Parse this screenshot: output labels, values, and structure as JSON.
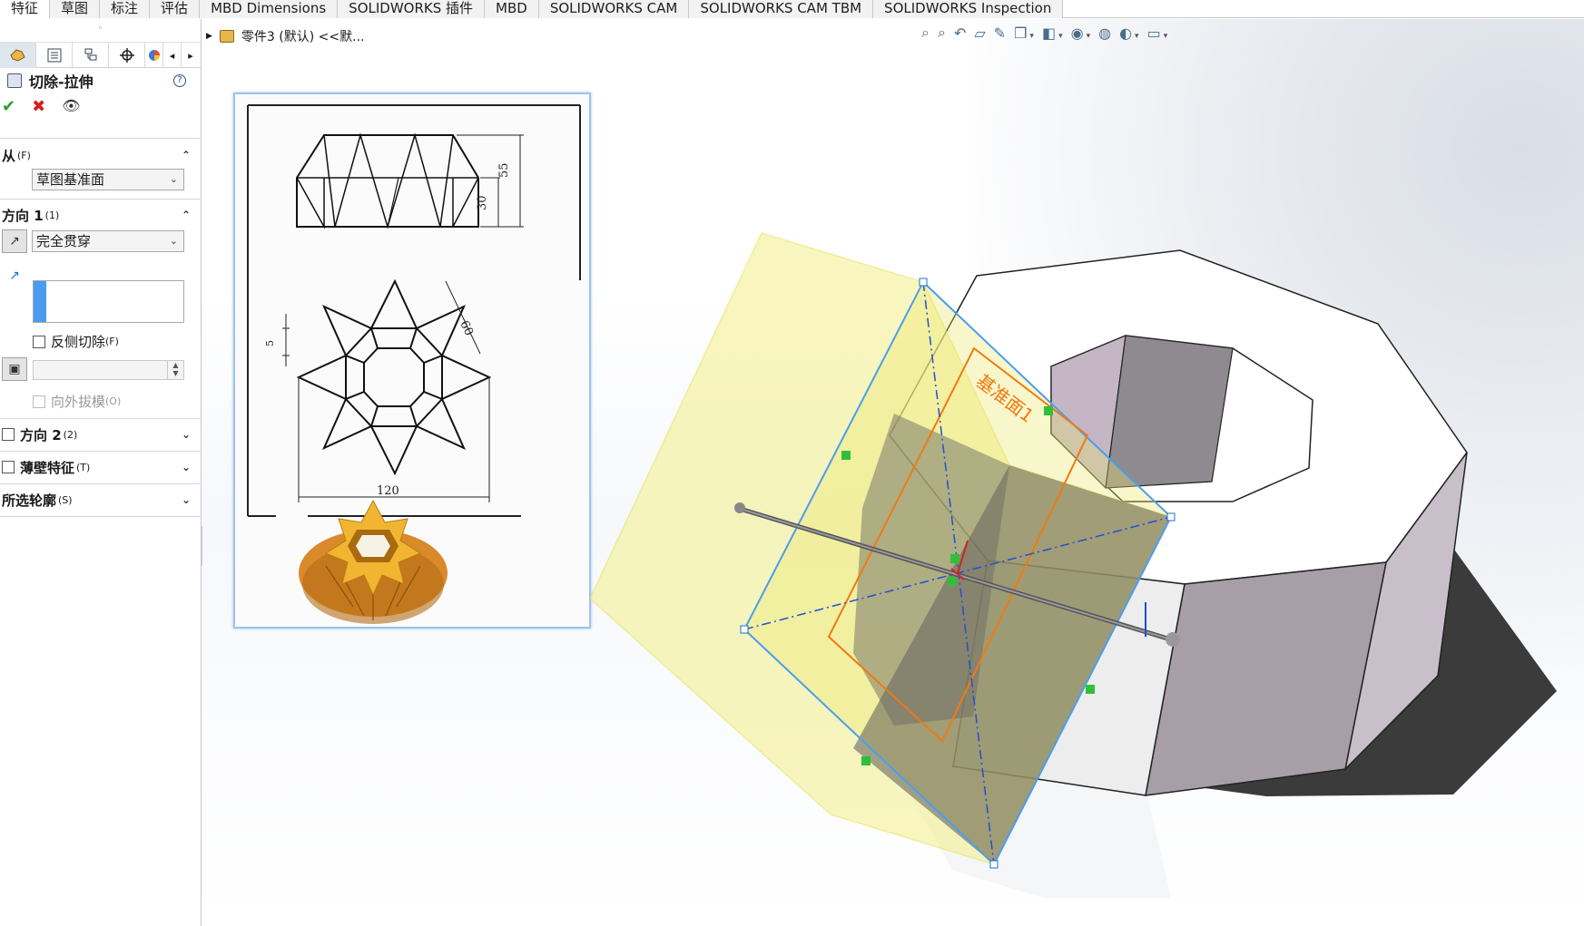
{
  "tabs": [
    {
      "label": "特征",
      "active": true
    },
    {
      "label": "草图",
      "active": false
    },
    {
      "label": "标注",
      "active": false
    },
    {
      "label": "评估",
      "active": false
    },
    {
      "label": "MBD Dimensions",
      "active": false
    },
    {
      "label": "SOLIDWORKS 插件",
      "active": false
    },
    {
      "label": "MBD",
      "active": false
    },
    {
      "label": "SOLIDWORKS CAM",
      "active": false
    },
    {
      "label": "SOLIDWORKS CAM TBM",
      "active": false
    },
    {
      "label": "SOLIDWORKS Inspection",
      "active": false
    }
  ],
  "breadcrumb": {
    "part_name": "零件3 (默认) <<默..."
  },
  "property_manager": {
    "title": "切除-拉伸",
    "help": "?",
    "from": {
      "label": "从",
      "shortcut": "(F)",
      "value": "草图基准面"
    },
    "direction1": {
      "label": "方向 1",
      "shortcut": "(1)",
      "end_condition": "完全贯穿",
      "flip_side": "反侧切除",
      "flip_side_shortcut": "(F)",
      "draft_outward": "向外拔模",
      "draft_outward_shortcut": "(O)"
    },
    "direction2": {
      "label": "方向 2",
      "shortcut": "(2)"
    },
    "thin_feature": {
      "label": "薄壁特征",
      "shortcut": "(T)"
    },
    "selected_contours": {
      "label": "所选轮廓",
      "shortcut": "(S)"
    }
  },
  "reference_drawing": {
    "dim_55": "55",
    "dim_30": "30",
    "dim_5": "5",
    "dim_60": "60",
    "dim_120": "120"
  },
  "viewport": {
    "plane_label": "基准面1"
  },
  "colors": {
    "plane_fill": "#f4f08a",
    "plane_edge": "#4a9ef0",
    "sketch_orange": "#f07a12",
    "solid_side": "#b9aeba",
    "solid_top": "#ffffff",
    "check_green": "#2e9d2e",
    "cancel_red": "#d42020"
  }
}
